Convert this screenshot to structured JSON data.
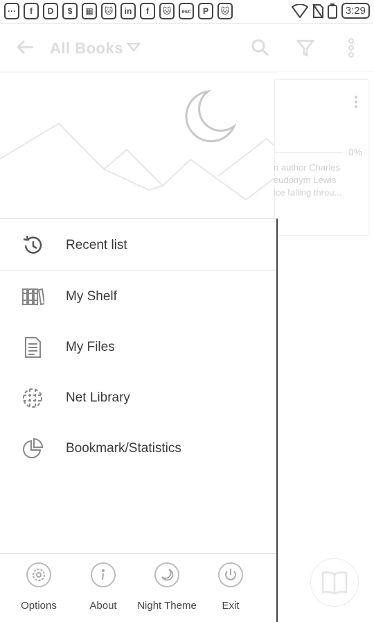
{
  "status_bar": {
    "time": "3:29",
    "notification_icons": [
      "···",
      "f",
      "D",
      "$",
      "▦",
      "🐱",
      "in",
      "f",
      "🐱",
      "esc",
      "P",
      "🐱"
    ]
  },
  "app_bar": {
    "title": "All Books"
  },
  "book_card": {
    "progress": "0%",
    "progress_fraction": 0,
    "desc_lines": [
      "n author Charles",
      "eudonym Lewis",
      "ice falling throu..."
    ]
  },
  "drawer": {
    "menu": [
      {
        "label": "Recent list",
        "icon": "history-icon"
      },
      {
        "label": "My Shelf",
        "icon": "bookshelf-icon"
      },
      {
        "label": "My Files",
        "icon": "file-icon"
      },
      {
        "label": "Net Library",
        "icon": "globe-icon"
      },
      {
        "label": "Bookmark/Statistics",
        "icon": "pie-chart-icon"
      }
    ],
    "bottom": [
      {
        "label": "Options",
        "icon": "gear-icon"
      },
      {
        "label": "About",
        "icon": "info-icon"
      },
      {
        "label": "Night Theme",
        "icon": "moon-icon"
      },
      {
        "label": "Exit",
        "icon": "power-icon"
      }
    ]
  },
  "colors": {
    "accent": "#444444",
    "faded": "#dcdcdc"
  }
}
